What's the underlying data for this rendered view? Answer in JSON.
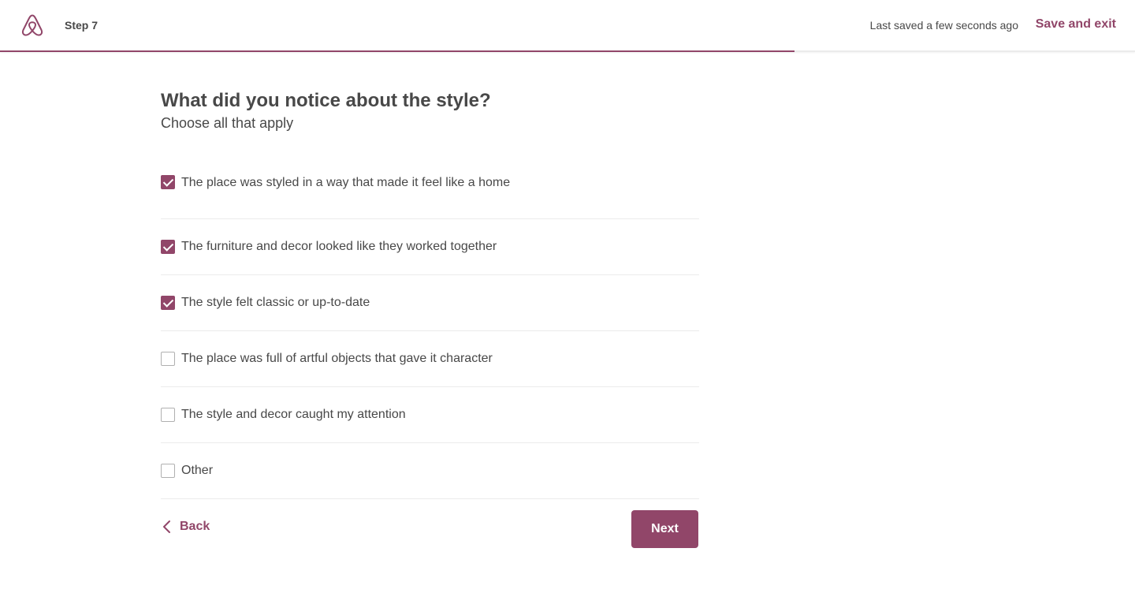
{
  "header": {
    "step_label": "Step 7",
    "last_saved": "Last saved a few seconds ago",
    "save_exit_label": "Save and exit",
    "progress_fraction": 0.7
  },
  "main": {
    "question": "What did you notice about the style?",
    "subtitle": "Choose all that apply",
    "options": [
      {
        "label": "The place was styled in a way that made it feel like a home",
        "checked": true
      },
      {
        "label": "The furniture and decor looked like they worked together",
        "checked": true
      },
      {
        "label": "The style felt classic or up-to-date",
        "checked": true
      },
      {
        "label": "The place was full of artful objects that gave it character",
        "checked": false
      },
      {
        "label": "The style and decor caught my attention",
        "checked": false
      },
      {
        "label": "Other",
        "checked": false
      }
    ]
  },
  "footer": {
    "back_label": "Back",
    "next_label": "Next"
  },
  "colors": {
    "accent": "#914669",
    "text": "#484848",
    "divider": "#ebebeb"
  }
}
